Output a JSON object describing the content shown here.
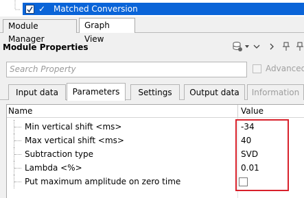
{
  "tree": {
    "selected_item_label": "Matched Conversion"
  },
  "view_tabs": [
    {
      "label": "Module Manager"
    },
    {
      "label": "Graph View"
    }
  ],
  "module_properties": {
    "title": "Module Properties",
    "header_icons": [
      "database-gear-icon",
      "chevron-down-icon",
      "chevron-right-icon",
      "pin-icon",
      "dock-icon"
    ]
  },
  "search": {
    "placeholder": "Search Property"
  },
  "advanced": {
    "label": "Advanced",
    "checked": false
  },
  "param_tabs": [
    {
      "label": "Input data",
      "active": false,
      "disabled": false
    },
    {
      "label": "Parameters",
      "active": true,
      "disabled": false
    },
    {
      "label": "Settings",
      "active": false,
      "disabled": false
    },
    {
      "label": "Output data",
      "active": false,
      "disabled": false
    },
    {
      "label": "Information",
      "active": false,
      "disabled": true
    }
  ],
  "grid": {
    "columns": {
      "name": "Name",
      "value": "Value"
    },
    "rows": [
      {
        "name": "Min vertical shift <ms>",
        "value": "-34"
      },
      {
        "name": "Max vertical shift <ms>",
        "value": "40"
      },
      {
        "name": "Subtraction type",
        "value": "SVD"
      },
      {
        "name": "Lambda <%>",
        "value": "0.01"
      },
      {
        "name": "Put maximum amplitude on zero time",
        "value": "",
        "checkbox": true,
        "checked": false
      }
    ]
  },
  "colors": {
    "selection": "#0a64d8",
    "highlight_box": "#d8202a"
  }
}
